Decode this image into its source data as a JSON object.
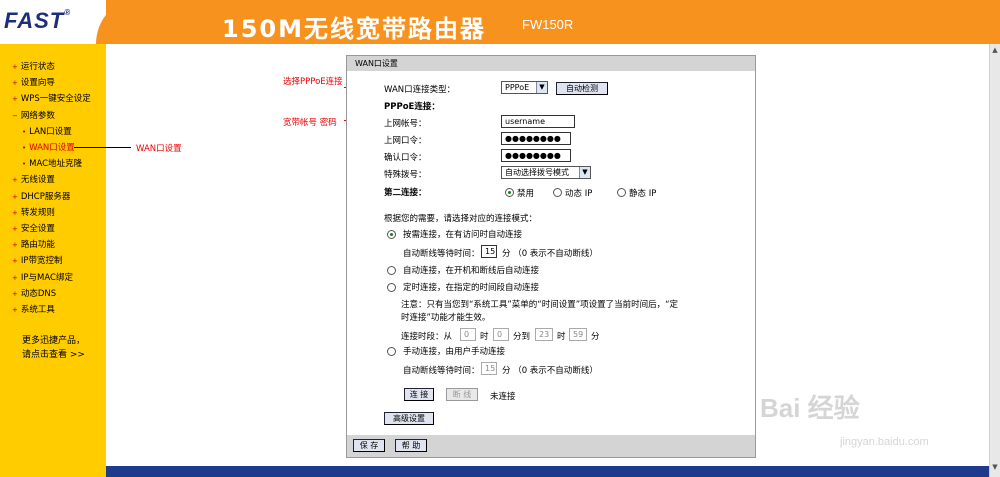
{
  "header": {
    "logo": "FAST",
    "logo_mark": "®",
    "title": "150M无线宽带路由器",
    "model": "FW150R"
  },
  "sidebar": {
    "items": [
      {
        "label": "运行状态"
      },
      {
        "label": "设置向导"
      },
      {
        "label": "WPS一键安全设定"
      },
      {
        "label": "网络参数"
      },
      {
        "label": "LAN口设置"
      },
      {
        "label": "WAN口设置"
      },
      {
        "label": "MAC地址克隆"
      },
      {
        "label": "无线设置"
      },
      {
        "label": "DHCP服务器"
      },
      {
        "label": "转发规则"
      },
      {
        "label": "安全设置"
      },
      {
        "label": "路由功能"
      },
      {
        "label": "IP带宽控制"
      },
      {
        "label": "IP与MAC绑定"
      },
      {
        "label": "动态DNS"
      },
      {
        "label": "系统工具"
      }
    ],
    "more_line1": "更多迅捷产品，",
    "more_line2": "请点击查看 >>"
  },
  "annotations": {
    "select_pppoe": "选择PPPoE连接",
    "account_password": "宽带帐号 密码",
    "wan_setting": "WAN口设置"
  },
  "panel": {
    "title": "WAN口设置",
    "conn_type_label": "WAN口连接类型：",
    "conn_type_value": "PPPoE",
    "auto_detect": "自动检测",
    "pppoe_label": "PPPoE连接：",
    "account_label": "上网帐号：",
    "account_value": "username",
    "password_label": "上网口令：",
    "password_value": "●●●●●●●●",
    "confirm_label": "确认口令：",
    "confirm_value": "●●●●●●●●",
    "dial_label": "特殊拨号：",
    "dial_value": "自动选择拨号模式",
    "second_conn_label": "第二连接：",
    "second_opts": [
      "禁用",
      "动态 IP",
      "静态 IP"
    ],
    "mode_prompt": "根据您的需要，请选择对应的连接模式：",
    "mode_demand": "按需连接，在有访问时自动连接",
    "idle_label": "自动断线等待时间：",
    "idle_value": "15",
    "idle_unit": "分 （0 表示不自动断线）",
    "mode_auto": "自动连接，在开机和断线后自动连接",
    "mode_timed": "定时连接，在指定的时间段自动连接",
    "note_line1": "注意：只有当您到“系统工具”菜单的“时间设置”项设置了当前时间后，“定",
    "note_line2": "时连接”功能才能生效。",
    "period_label": "连接时段：从",
    "period_from_h": "0",
    "period_h": "时",
    "period_from_m": "0",
    "period_to": "分到",
    "period_to_h": "23",
    "period_to_m": "59",
    "period_m": "分",
    "mode_manual": "手动连接，由用户手动连接",
    "idle2_label": "自动断线等待时间：",
    "idle2_value": "15",
    "idle2_unit": "分 （0 表示不自动断线）",
    "connect": "连 接",
    "disconnect": "断 线",
    "status": "未连接",
    "advanced": "高级设置",
    "save": "保 存",
    "help": "帮 助"
  },
  "watermark": {
    "brand": "Bai 经验",
    "url": "jingyan.baidu.com"
  }
}
